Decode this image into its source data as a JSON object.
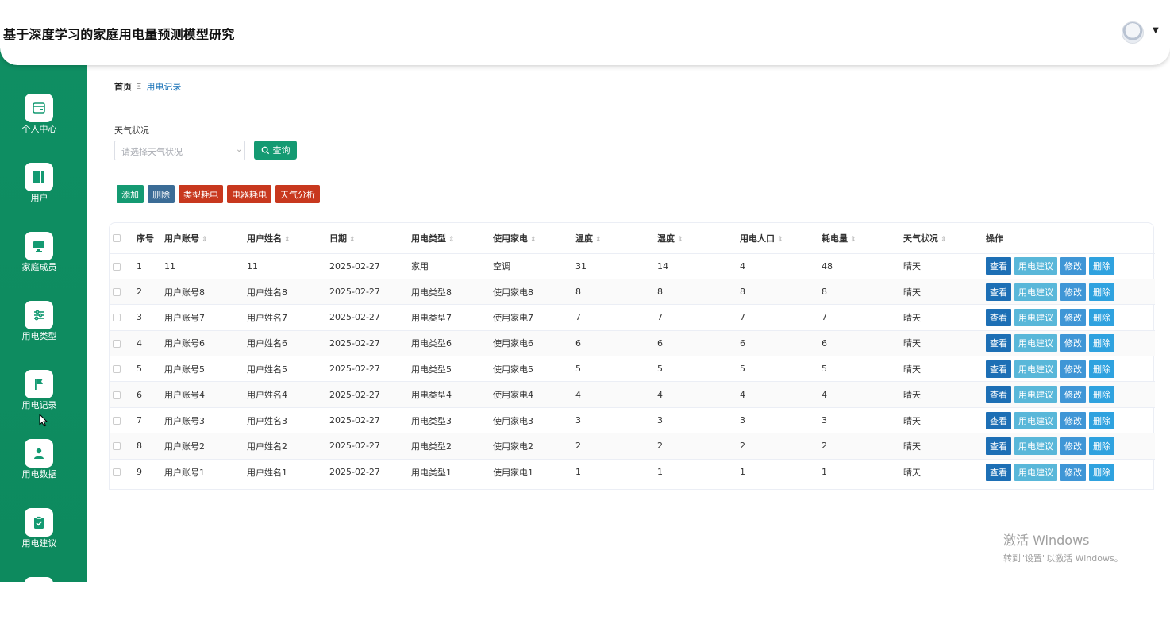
{
  "app": {
    "title": "基于深度学习的家庭用电量预测模型研究"
  },
  "sidebar": {
    "items": [
      {
        "label": "个人中心",
        "icon": "wallet-icon"
      },
      {
        "label": "用户",
        "icon": "grid-icon"
      },
      {
        "label": "家庭成员",
        "icon": "monitor-icon"
      },
      {
        "label": "用电类型",
        "icon": "sliders-icon"
      },
      {
        "label": "用电记录",
        "icon": "flag-icon"
      },
      {
        "label": "用电数据",
        "icon": "user-icon"
      },
      {
        "label": "用电建议",
        "icon": "clipboard-check-icon"
      }
    ]
  },
  "breadcrumb": {
    "home": "首页",
    "separator": "Ξ",
    "current": "用电记录"
  },
  "filter": {
    "label": "天气状况",
    "placeholder": "请选择天气状况",
    "search_label": "查询"
  },
  "actions": {
    "add": "添加",
    "delete": "删除",
    "type_usage": "类型耗电",
    "appliance_usage": "电器耗电",
    "weather_analysis": "天气分析"
  },
  "table": {
    "headers": [
      "序号",
      "用户账号",
      "用户姓名",
      "日期",
      "用电类型",
      "使用家电",
      "温度",
      "湿度",
      "用电人口",
      "耗电量",
      "天气状况",
      "操作"
    ],
    "rows": [
      [
        "1",
        "11",
        "11",
        "2025-02-27",
        "家用",
        "空调",
        "31",
        "14",
        "4",
        "48",
        "晴天"
      ],
      [
        "2",
        "用户账号8",
        "用户姓名8",
        "2025-02-27",
        "用电类型8",
        "使用家电8",
        "8",
        "8",
        "8",
        "8",
        "晴天"
      ],
      [
        "3",
        "用户账号7",
        "用户姓名7",
        "2025-02-27",
        "用电类型7",
        "使用家电7",
        "7",
        "7",
        "7",
        "7",
        "晴天"
      ],
      [
        "4",
        "用户账号6",
        "用户姓名6",
        "2025-02-27",
        "用电类型6",
        "使用家电6",
        "6",
        "6",
        "6",
        "6",
        "晴天"
      ],
      [
        "5",
        "用户账号5",
        "用户姓名5",
        "2025-02-27",
        "用电类型5",
        "使用家电5",
        "5",
        "5",
        "5",
        "5",
        "晴天"
      ],
      [
        "6",
        "用户账号4",
        "用户姓名4",
        "2025-02-27",
        "用电类型4",
        "使用家电4",
        "4",
        "4",
        "4",
        "4",
        "晴天"
      ],
      [
        "7",
        "用户账号3",
        "用户姓名3",
        "2025-02-27",
        "用电类型3",
        "使用家电3",
        "3",
        "3",
        "3",
        "3",
        "晴天"
      ],
      [
        "8",
        "用户账号2",
        "用户姓名2",
        "2025-02-27",
        "用电类型2",
        "使用家电2",
        "2",
        "2",
        "2",
        "2",
        "晴天"
      ],
      [
        "9",
        "用户账号1",
        "用户姓名1",
        "2025-02-27",
        "用电类型1",
        "使用家电1",
        "1",
        "1",
        "1",
        "1",
        "晴天"
      ]
    ],
    "row_actions": {
      "view": "查看",
      "advice": "用电建议",
      "edit": "修改",
      "delete": "删除"
    }
  },
  "watermark": {
    "line1": "激活 Windows",
    "line2": "转到\"设置\"以激活 Windows。"
  },
  "colors": {
    "sidebar": "#0f8f63",
    "primary": "#149a72",
    "danger": "#c8381e",
    "link": "#1a73b8"
  }
}
